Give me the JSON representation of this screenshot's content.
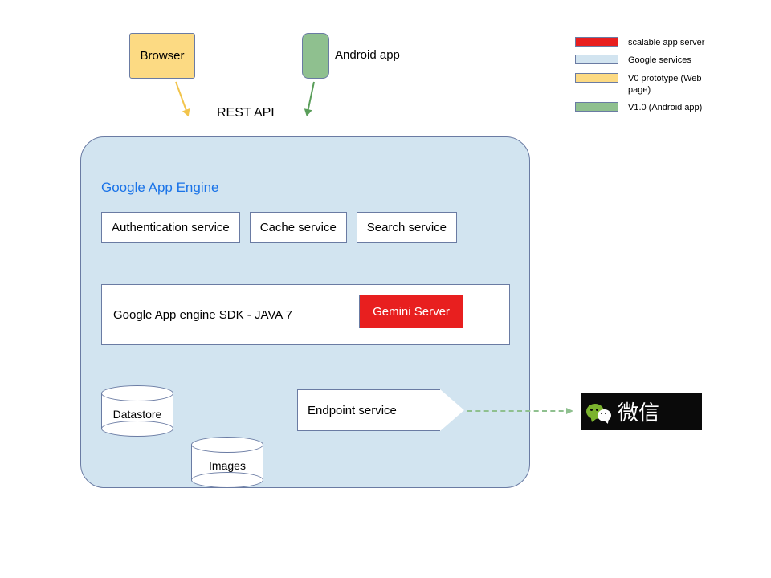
{
  "clients": {
    "browser": "Browser",
    "android": "Android app"
  },
  "api_label": "REST API",
  "gae": {
    "title": "Google App Engine",
    "services": [
      "Authentication service",
      "Cache service",
      "Search service"
    ],
    "sdk_label": "Google App engine SDK  - JAVA 7",
    "gemini": "Gemini Server",
    "datastore": "Datastore",
    "images": "Images",
    "endpoint": "Endpoint service"
  },
  "external": {
    "wechat": "微信"
  },
  "legend": [
    {
      "color": "red",
      "label": "scalable app server"
    },
    {
      "color": "blue",
      "label": "Google services"
    },
    {
      "color": "yellow",
      "label": "V0 prototype (Web page)"
    },
    {
      "color": "green",
      "label": "V1.0 (Android app)"
    }
  ]
}
